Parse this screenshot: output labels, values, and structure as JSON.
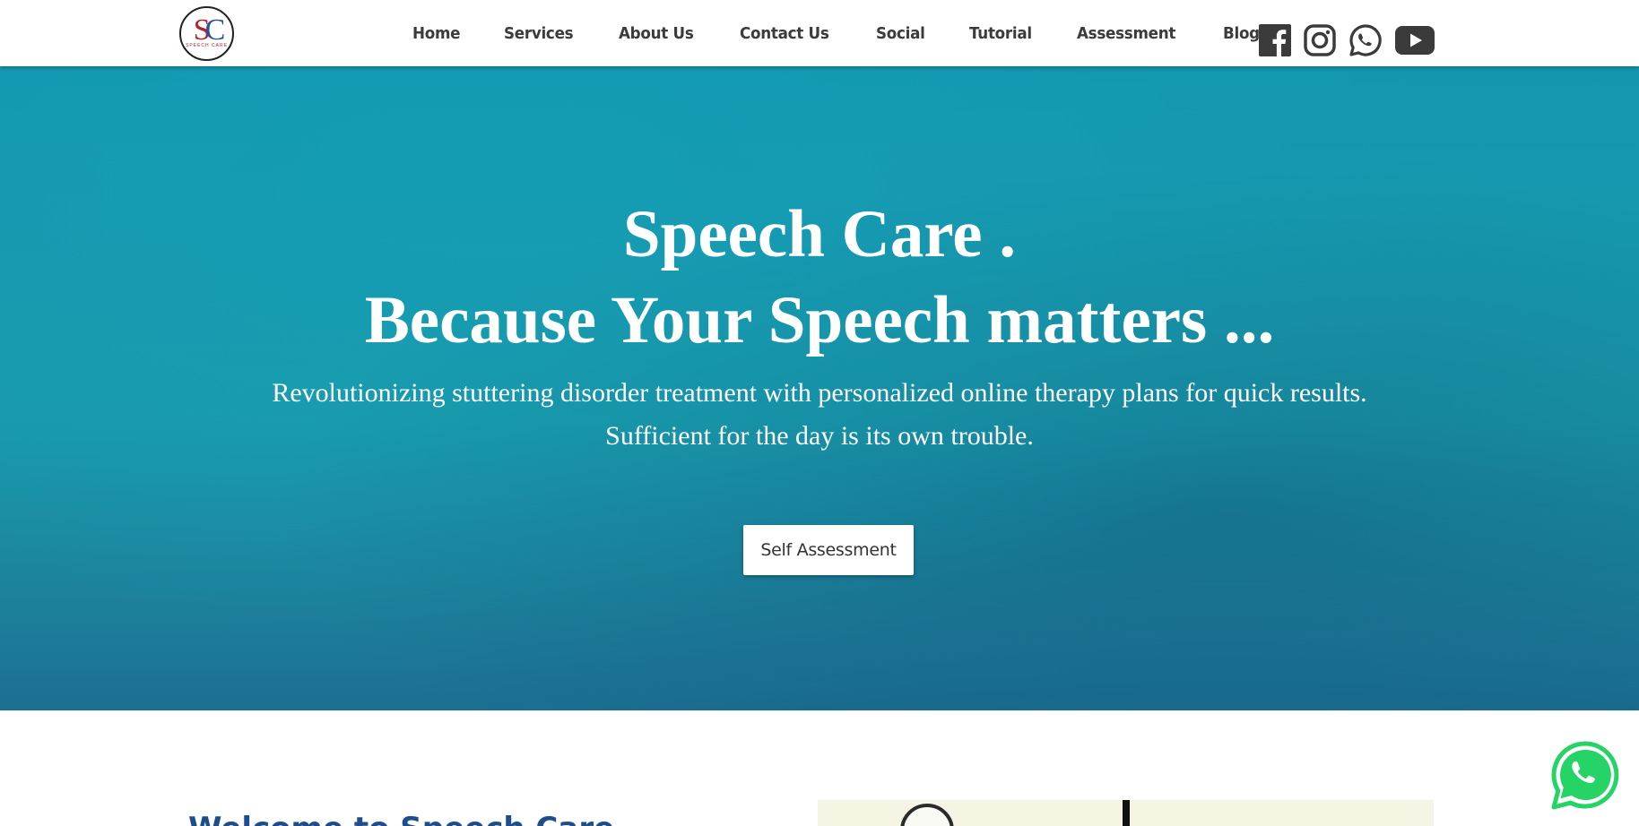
{
  "brand": {
    "logo_letters_s": "S",
    "logo_letters_c": "C",
    "logo_sub": "SPEECH CARE"
  },
  "nav": {
    "items": [
      {
        "label": "Home"
      },
      {
        "label": "Services"
      },
      {
        "label": "About Us"
      },
      {
        "label": "Contact Us"
      },
      {
        "label": "Social"
      },
      {
        "label": "Tutorial"
      },
      {
        "label": "Assessment"
      },
      {
        "label": "Blog"
      }
    ]
  },
  "socials": [
    {
      "icon": "facebook-icon"
    },
    {
      "icon": "instagram-icon"
    },
    {
      "icon": "whatsapp-icon"
    },
    {
      "icon": "youtube-icon"
    }
  ],
  "hero": {
    "title_line1": "Speech Care .",
    "title_line2": "Because Your Speech matters ...",
    "subtitle_line1": "Revolutionizing stuttering disorder treatment with personalized online therapy plans for quick results.",
    "subtitle_line2": "Sufficient for the day is its own trouble.",
    "cta_label": "Self Assessment"
  },
  "welcome": {
    "heading": "Welcome to Speech Care"
  },
  "colors": {
    "hero_bg": "#1397b1",
    "nav_text": "#3b3b3b",
    "heading_blue": "#1e4d8c",
    "whatsapp_green": "#25d366"
  }
}
